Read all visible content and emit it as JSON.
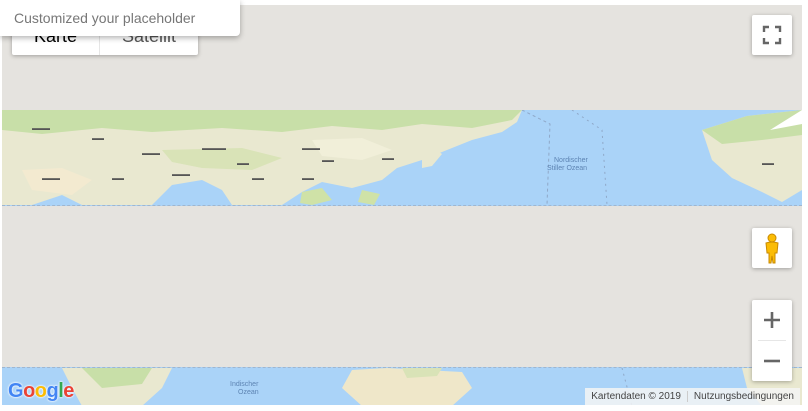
{
  "search": {
    "placeholder": "Customized your placeholder"
  },
  "map_type": {
    "map_label": "Karte",
    "satellite_label": "Satellit"
  },
  "labels_top": [
    "Nordischer",
    "Stiller Ozean"
  ],
  "labels_bottom": [
    "Indischer",
    "Ozean"
  ],
  "logo": {
    "letters": [
      "G",
      "o",
      "o",
      "g",
      "l",
      "e"
    ],
    "colors": [
      "#4285f4",
      "#ea4335",
      "#fbbc05",
      "#4285f4",
      "#34a853",
      "#ea4335"
    ]
  },
  "attribution": {
    "map_data": "Kartendaten © 2019",
    "terms": "Nutzungsbedingungen"
  },
  "icons": {
    "fullscreen": "fullscreen-icon",
    "pegman": "pegman-icon",
    "zoom_in": "plus-icon",
    "zoom_out": "minus-icon"
  }
}
